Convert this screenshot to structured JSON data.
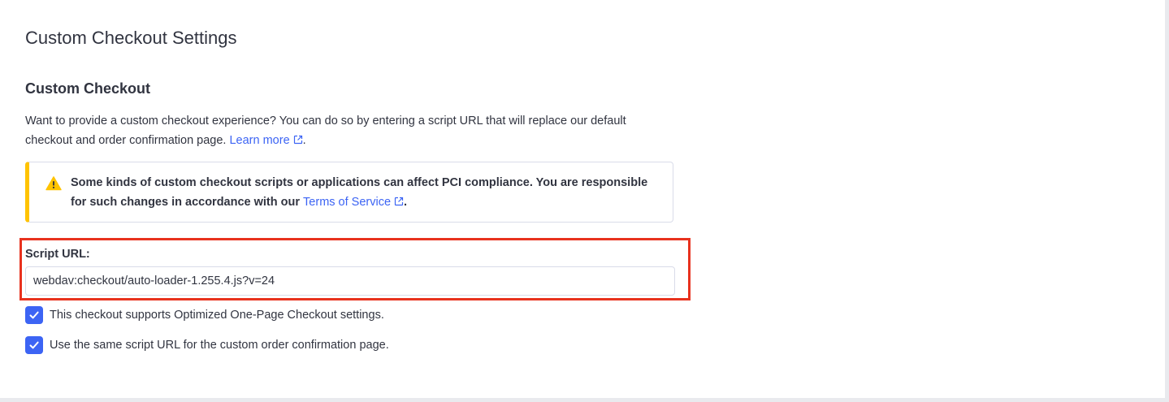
{
  "page": {
    "title": "Custom Checkout Settings"
  },
  "section": {
    "title": "Custom Checkout",
    "description": "Want to provide a custom checkout experience? You can do so by entering a script URL that will replace our default checkout and order confirmation page.",
    "description_before_link": "Want to provide a custom checkout experience? You can do so by entering a script URL that will replace our default checkout and order confirmation page. ",
    "learn_more_label": "Learn more",
    "description_after_link": "."
  },
  "alert": {
    "text_before_link": "Some kinds of custom checkout scripts or applications can affect PCI compliance. You are responsible for such changes in accordance with our ",
    "link_label": "Terms of Service",
    "text_after_link": ".",
    "icon": "warning-triangle-icon",
    "accent_color": "#ffc300"
  },
  "script_url": {
    "label": "Script URL:",
    "value": "webdav:checkout/auto-loader-1.255.4.js?v=24"
  },
  "options": [
    {
      "label": "This checkout supports Optimized One-Page Checkout settings.",
      "checked": true
    },
    {
      "label": "Use the same script URL for the custom order confirmation page.",
      "checked": true
    }
  ],
  "colors": {
    "link": "#3c64f4",
    "checkbox": "#3c64f4",
    "highlight": "#e8321e",
    "text": "#313440"
  }
}
